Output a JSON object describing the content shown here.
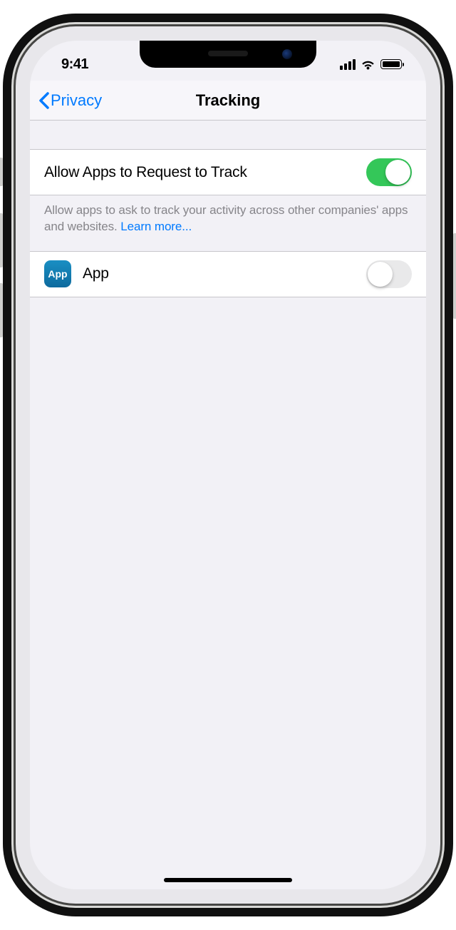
{
  "status": {
    "time": "9:41"
  },
  "nav": {
    "back_label": "Privacy",
    "title": "Tracking"
  },
  "settings": {
    "allow_request": {
      "label": "Allow Apps to Request to Track",
      "enabled": true
    },
    "footer_text": "Allow apps to ask to track your activity across other companies' apps and websites. ",
    "learn_more": "Learn more...",
    "apps": [
      {
        "icon_text": "App",
        "name": "App",
        "enabled": false
      }
    ]
  }
}
